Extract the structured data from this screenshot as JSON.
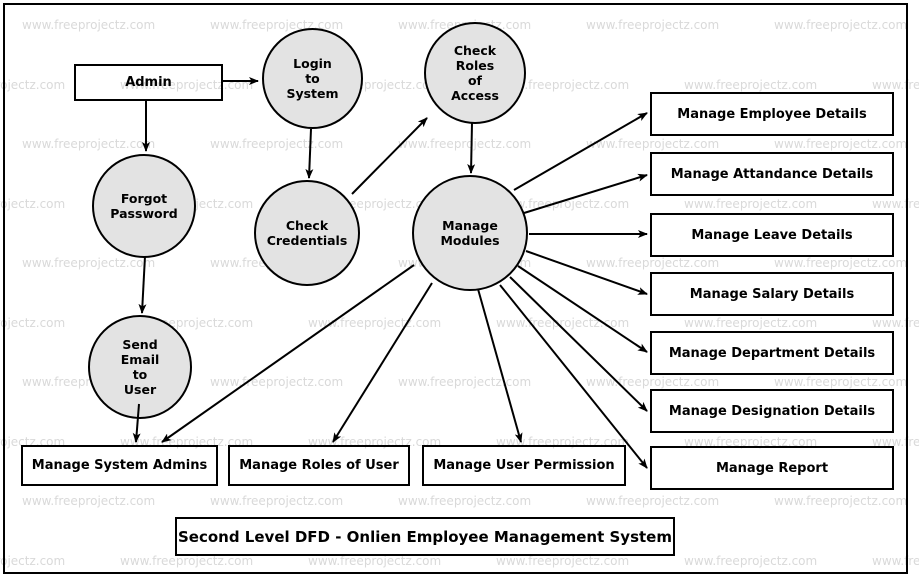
{
  "diagram": {
    "title": "Second Level DFD - Onlien Employee Management System",
    "fill_color": "#e3e3e3",
    "stroke_color": "#000000",
    "watermark_text": "www.freeprojectz.com",
    "watermark_color": "#d9d9d9"
  },
  "entities": [
    {
      "id": "admin",
      "label": "Admin",
      "shape": "rectangle"
    }
  ],
  "processes": [
    {
      "id": "login",
      "label": "Login\nto\nSystem",
      "shape": "circle"
    },
    {
      "id": "check_roles",
      "label": "Check\nRoles\nof\nAccess",
      "shape": "circle"
    },
    {
      "id": "forgot",
      "label": "Forgot\nPassword",
      "shape": "circle"
    },
    {
      "id": "credentials",
      "label": "Check\nCredentials",
      "shape": "circle"
    },
    {
      "id": "modules",
      "label": "Manage\nModules",
      "shape": "circle"
    },
    {
      "id": "send_email",
      "label": "Send\nEmail\nto\nUser",
      "shape": "circle"
    }
  ],
  "modules_right": [
    {
      "id": "employee",
      "label": "Manage Employee Details"
    },
    {
      "id": "attandance",
      "label": "Manage Attandance Details"
    },
    {
      "id": "leave",
      "label": "Manage Leave Details"
    },
    {
      "id": "salary",
      "label": "Manage Salary Details"
    },
    {
      "id": "department",
      "label": "Manage Department Details"
    },
    {
      "id": "designation",
      "label": "Manage Designation Details"
    },
    {
      "id": "report",
      "label": "Manage Report"
    }
  ],
  "modules_bottom": [
    {
      "id": "system_admins",
      "label": "Manage System Admins"
    },
    {
      "id": "roles_of_user",
      "label": "Manage Roles of User"
    },
    {
      "id": "user_permission",
      "label": "Manage User Permission"
    }
  ],
  "flows": [
    {
      "from": "admin",
      "to": "login"
    },
    {
      "from": "admin",
      "to": "forgot"
    },
    {
      "from": "login",
      "to": "credentials"
    },
    {
      "from": "credentials",
      "to": "check_roles"
    },
    {
      "from": "check_roles",
      "to": "modules"
    },
    {
      "from": "forgot",
      "to": "send_email"
    },
    {
      "from": "send_email",
      "to": "system_admins"
    },
    {
      "from": "modules",
      "to": "employee"
    },
    {
      "from": "modules",
      "to": "attandance"
    },
    {
      "from": "modules",
      "to": "leave"
    },
    {
      "from": "modules",
      "to": "salary"
    },
    {
      "from": "modules",
      "to": "department"
    },
    {
      "from": "modules",
      "to": "designation"
    },
    {
      "from": "modules",
      "to": "report"
    },
    {
      "from": "modules",
      "to": "system_admins"
    },
    {
      "from": "modules",
      "to": "roles_of_user"
    },
    {
      "from": "modules",
      "to": "user_permission"
    }
  ]
}
